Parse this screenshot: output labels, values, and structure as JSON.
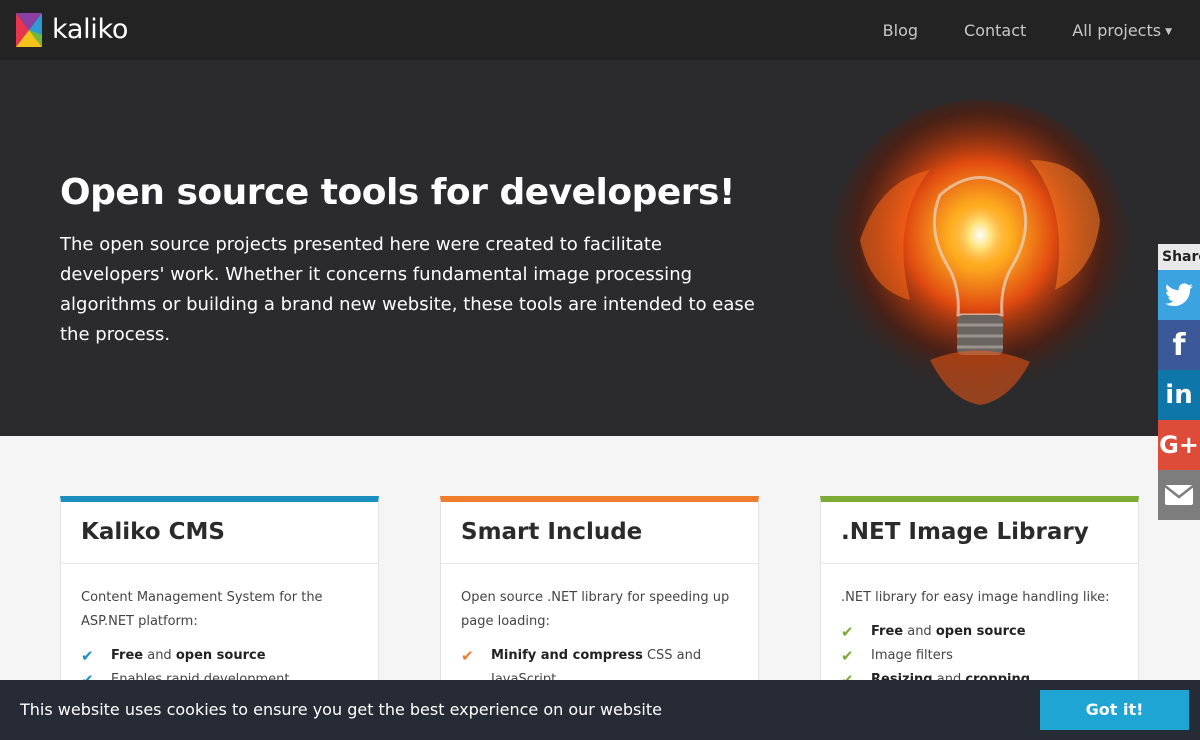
{
  "header": {
    "logo_text": "kaliko",
    "nav": [
      {
        "label": "Blog"
      },
      {
        "label": "Contact"
      },
      {
        "label": "All projects"
      }
    ]
  },
  "hero": {
    "title": "Open source tools for developers!",
    "text": "The open source projects presented here were created to facilitate developers' work. Whether it concerns fundamental image processing algorithms or building a brand new website, these tools are intended to ease the process."
  },
  "share": {
    "label": "Share",
    "buttons": [
      {
        "icon": "twitter-icon",
        "color": "#3aa3e0"
      },
      {
        "icon": "facebook-icon",
        "glyph": "f",
        "color": "#3b5998"
      },
      {
        "icon": "linkedin-icon",
        "glyph": "in",
        "color": "#0e76a8"
      },
      {
        "icon": "google-plus-icon",
        "glyph": "G+",
        "color": "#dd4b39"
      },
      {
        "icon": "email-icon",
        "color": "#7d7d7d"
      }
    ]
  },
  "cards": [
    {
      "title": "Kaliko CMS",
      "accent": "#1b8fbd",
      "description": "Content Management System for the ASP.NET platform:",
      "features": [
        {
          "strong": "Free",
          "mid": " and ",
          "strong2": "open source",
          "rest": ""
        },
        {
          "strong": "",
          "mid": "",
          "strong2": "",
          "rest": "Enables rapid development"
        }
      ]
    },
    {
      "title": "Smart Include",
      "accent": "#ef7d2c",
      "description": "Open source .NET library for speeding up page loading:",
      "features": [
        {
          "strong": "Minify and compress",
          "rest": " CSS and JavaScript"
        }
      ]
    },
    {
      "title": ".NET Image Library",
      "accent": "#7cab36",
      "description": ".NET library for easy image handling like:",
      "features": [
        {
          "strong": "Free",
          "mid": " and ",
          "strong2": "open source",
          "rest": ""
        },
        {
          "strong": "",
          "mid": "",
          "strong2": "",
          "rest": "Image filters"
        },
        {
          "strong": "Resizing",
          "mid": " and ",
          "strong2": "cropping",
          "rest": ""
        }
      ]
    }
  ],
  "cookie": {
    "message": "This website uses cookies to ensure you get the best experience on our website",
    "button": "Got it!"
  }
}
